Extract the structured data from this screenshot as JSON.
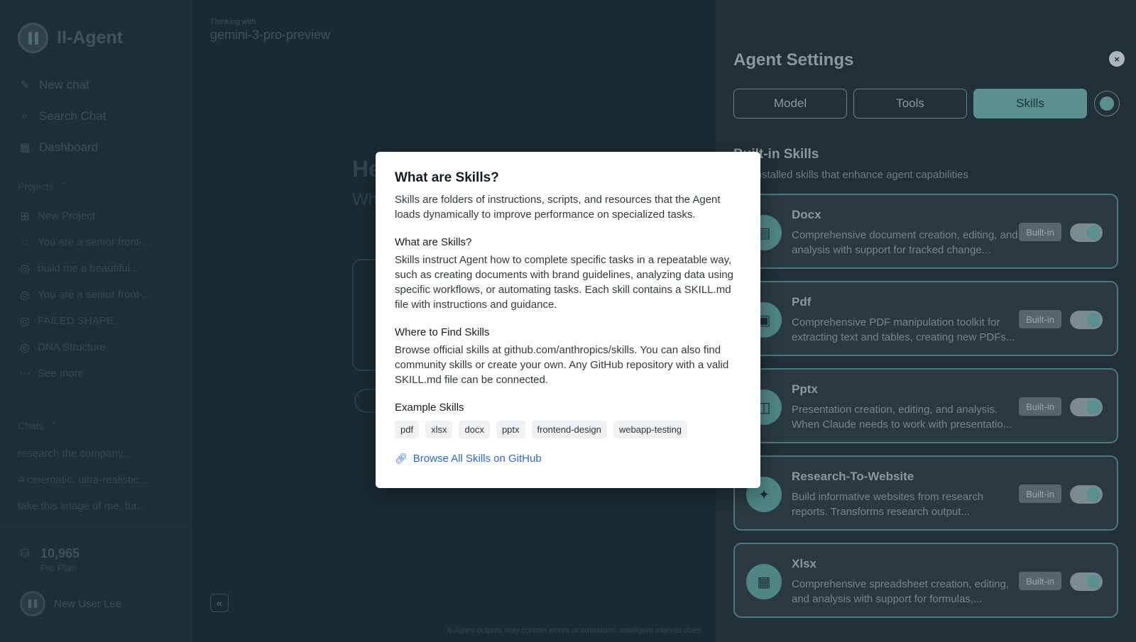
{
  "sidebar": {
    "brand": "II-Agent",
    "nav": [
      {
        "label": "New chat",
        "icon": "edit-icon"
      },
      {
        "label": "Search Chat",
        "icon": "search-icon"
      },
      {
        "label": "Dashboard",
        "icon": "grid-icon"
      }
    ],
    "projects_label": "Projects",
    "projects": [
      {
        "label": "New Project",
        "icon": "folder-plus-icon"
      },
      {
        "label": "You are a senior front-...",
        "icon": "chat-icon"
      },
      {
        "label": "build me a beautiful...",
        "icon": "globe-icon"
      },
      {
        "label": "You are a senior front-...",
        "icon": "globe-icon"
      },
      {
        "label": "FAILED SHAPE...",
        "icon": "globe-icon"
      },
      {
        "label": "DNA Structure",
        "icon": "globe-icon"
      },
      {
        "label": "See more",
        "icon": "ellipsis-icon"
      }
    ],
    "chats_label": "Chats",
    "chats": [
      "research the company...",
      "A cinematic, ultra-realistic...",
      "take this image of me, tur..."
    ],
    "credits": {
      "value": "10,965",
      "plan": "Pro Plan"
    },
    "user_name": "New User Lee"
  },
  "main": {
    "thinking_label": "Thinking with",
    "model": "gemini-3-pro-preview",
    "hello": "He",
    "sub": "Wh",
    "collapse_icon": "«",
    "disclaimer": "II-Agent outputs may contain errors or omissions. Intelligent Internet does"
  },
  "panel": {
    "title": "Agent Settings",
    "close_icon": "×",
    "tabs": [
      "Model",
      "Tools",
      "Skills"
    ],
    "active_tab": "Skills",
    "section_title": "Built-in Skills",
    "section_desc": "Pre-installed skills that enhance agent capabilities",
    "skills": [
      {
        "name": "Docx",
        "desc": "Comprehensive document creation, editing, and analysis with support for tracked change...",
        "badge": "Built-in",
        "icon": "document-icon",
        "glyph": "▤",
        "enabled": true
      },
      {
        "name": "Pdf",
        "desc": "Comprehensive PDF manipulation toolkit for extracting text and tables, creating new PDFs...",
        "badge": "Built-in",
        "icon": "pdf-icon",
        "glyph": "▣",
        "enabled": true
      },
      {
        "name": "Pptx",
        "desc": "Presentation creation, editing, and analysis. When Claude needs to work with presentatio...",
        "badge": "Built-in",
        "icon": "presentation-icon",
        "glyph": "◫",
        "enabled": true
      },
      {
        "name": "Research-To-Website",
        "desc": "Build informative websites from research reports. Transforms research output...",
        "badge": "Built-in",
        "icon": "sparkle-icon",
        "glyph": "✦",
        "enabled": true
      },
      {
        "name": "Xlsx",
        "desc": "Comprehensive spreadsheet creation, editing, and analysis with support for formulas,...",
        "badge": "Built-in",
        "icon": "spreadsheet-icon",
        "glyph": "▦",
        "enabled": true
      }
    ]
  },
  "modal": {
    "title": "What are Skills?",
    "intro": "Skills are folders of instructions, scripts, and resources that the Agent loads dynamically to improve performance on specialized tasks.",
    "sections": [
      {
        "heading": "What are Skills?",
        "body": "Skills instruct Agent how to complete specific tasks in a repeatable way, such as creating documents with brand guidelines, analyzing data using specific workflows, or automating tasks. Each skill contains a SKILL.md file with instructions and guidance."
      },
      {
        "heading": "Where to Find Skills",
        "body": "Browse official skills at github.com/anthropics/skills. You can also find community skills or create your own. Any GitHub repository with a valid SKILL.md file can be connected."
      }
    ],
    "examples_heading": "Example Skills",
    "examples": [
      "pdf",
      "xlsx",
      "docx",
      "pptx",
      "frontend-design",
      "webapp-testing"
    ],
    "link_label": "Browse All Skills on GitHub"
  },
  "colors": {
    "accent": "#5a8f8f",
    "link": "#2b66d9",
    "panel_bg": "#223038",
    "main_bg": "#1a2b33"
  }
}
